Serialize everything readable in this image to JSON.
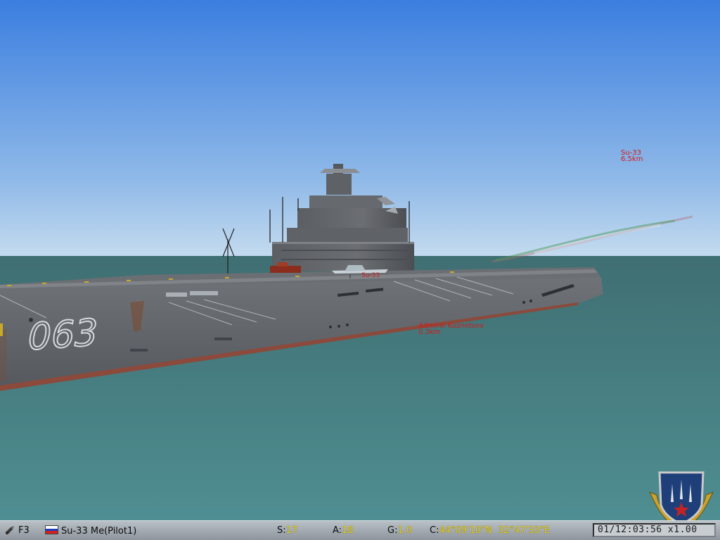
{
  "scene": {
    "hull_number": "063",
    "labels": {
      "aircraft": [
        "Su-33",
        "6.5km"
      ],
      "carrier": [
        "Admiral Kuznetsov",
        "0.3km"
      ],
      "deck_marker": "Su-33"
    }
  },
  "statusbar": {
    "view_key": "F3",
    "unit": "Su-33 Me(Pilot1)",
    "speed_label": "S:",
    "speed_value": "17",
    "alt_label": "A:",
    "alt_value": "18",
    "g_label": "G:",
    "g_value": "1.0",
    "coord_label": "C:",
    "coord_value": "44°09'10\"N  32°47'33\"E",
    "clock": "01/12:03:56 x1.00"
  },
  "flag_colors": [
    "#ffffff",
    "#1f3fbf",
    "#d02020"
  ],
  "colors": {
    "sky_top": "#3b7ee0",
    "sky_horizon": "#bcd4ea",
    "sea": "#4f8a8e",
    "hud_red": "#d81818",
    "hud_yellow": "#e8d31a"
  },
  "icons": [
    "view-camera-icon",
    "russia-flag-icon",
    "squadron-emblem-icon"
  ]
}
